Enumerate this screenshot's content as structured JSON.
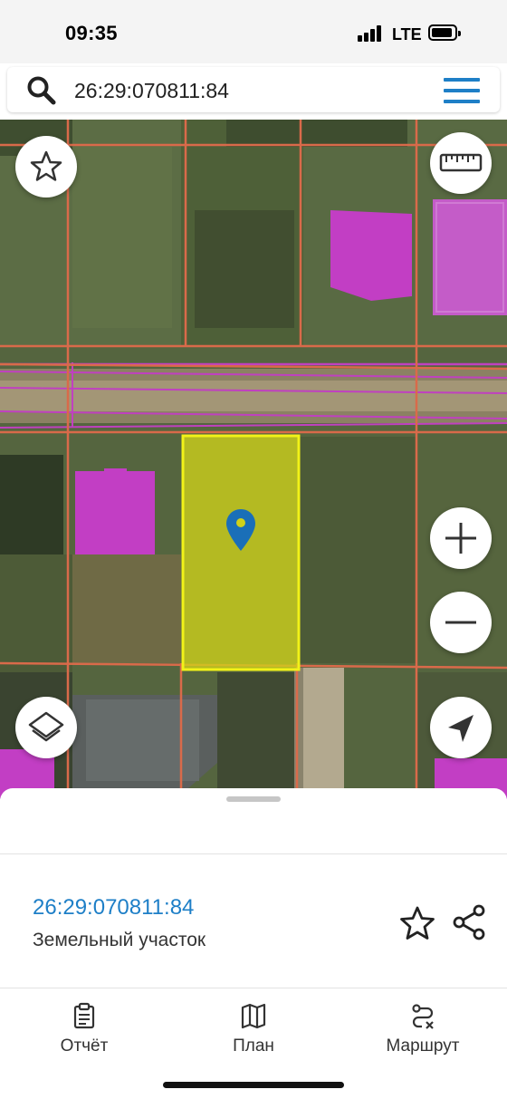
{
  "status_bar": {
    "time": "09:35",
    "network": "LTE"
  },
  "search": {
    "value": "26:29:070811:84"
  },
  "map": {
    "colors": {
      "parcel_fill": "#cfd21a",
      "parcel_border": "#f2f218",
      "boundary": "#d96a4a",
      "building": "#c23ec4",
      "road_line": "#c040c0",
      "marker": "#1a6fb8"
    }
  },
  "map_controls": [
    "favorite",
    "ruler",
    "zoom-in",
    "zoom-out",
    "layers",
    "locate"
  ],
  "sheet": {
    "parcel_id": "26:29:070811:84",
    "parcel_type": "Земельный участок"
  },
  "tabs": [
    {
      "label": "Отчёт",
      "icon": "report-icon"
    },
    {
      "label": "План",
      "icon": "map-icon"
    },
    {
      "label": "Маршрут",
      "icon": "route-icon"
    }
  ]
}
